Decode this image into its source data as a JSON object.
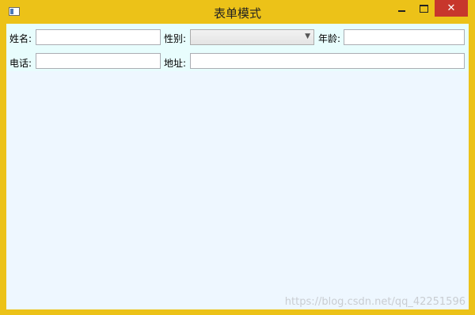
{
  "window": {
    "title": "表单模式",
    "close_glyph": "✕",
    "minimize_icon": "minimize-icon",
    "maximize_icon": "maximize-icon",
    "close_icon": "close-icon"
  },
  "form": {
    "name_label": "姓名:",
    "name_value": "",
    "gender_label": "性别:",
    "gender_selected": "",
    "age_label": "年龄:",
    "age_value": "",
    "phone_label": "电话:",
    "phone_value": "",
    "address_label": "地址:",
    "address_value": ""
  },
  "watermark": "https://blog.csdn.net/qq_42251596",
  "colors": {
    "frame": "#ecc218",
    "close": "#c7362c",
    "client": "#eef7ff"
  }
}
